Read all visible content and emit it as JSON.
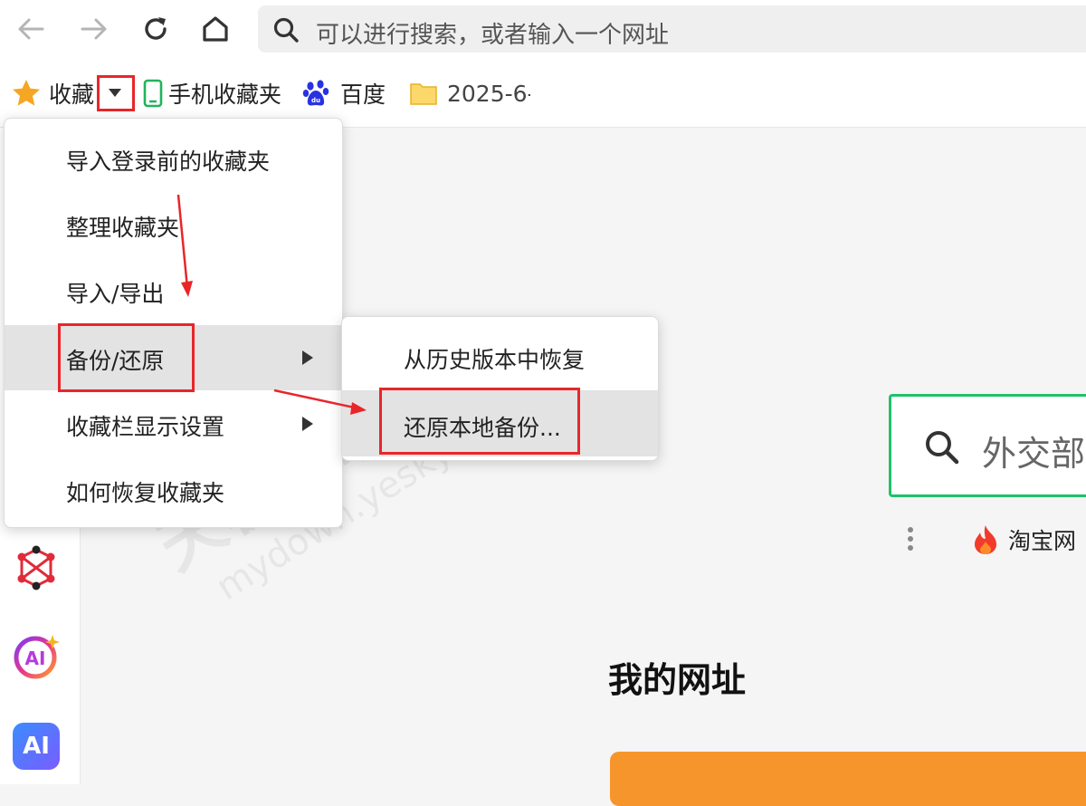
{
  "address_bar": {
    "placeholder": "可以进行搜索，或者输入一个网址"
  },
  "bookmarks_bar": {
    "favorites_label": "收藏",
    "items": [
      {
        "label": "手机收藏夹",
        "icon": "phone-icon"
      },
      {
        "label": "百度",
        "icon": "baidu-paw-icon"
      },
      {
        "label": "2025-6-",
        "icon": "folder-icon"
      }
    ]
  },
  "favorites_menu": {
    "items": [
      {
        "label": "导入登录前的收藏夹"
      },
      {
        "label": "整理收藏夹"
      },
      {
        "label": "导入/导出"
      },
      {
        "label": "备份/还原"
      },
      {
        "label": "收藏栏显示设置"
      },
      {
        "label": "如何恢复收藏夹"
      }
    ]
  },
  "backup_submenu": {
    "items": [
      {
        "label": "从历史版本中恢复"
      },
      {
        "label": "还原本地备份..."
      }
    ]
  },
  "main": {
    "search_text": "外交部",
    "quick_link": "淘宝网",
    "section_title": "我的网址"
  },
  "watermark": {
    "cn": "天极下载站",
    "en": "mydown.yesky.com"
  },
  "colors": {
    "highlight_red": "#e8262a",
    "search_border": "#1fc16a",
    "accent_orange": "#f5952b",
    "menu_hover": "#e3e3e3"
  }
}
